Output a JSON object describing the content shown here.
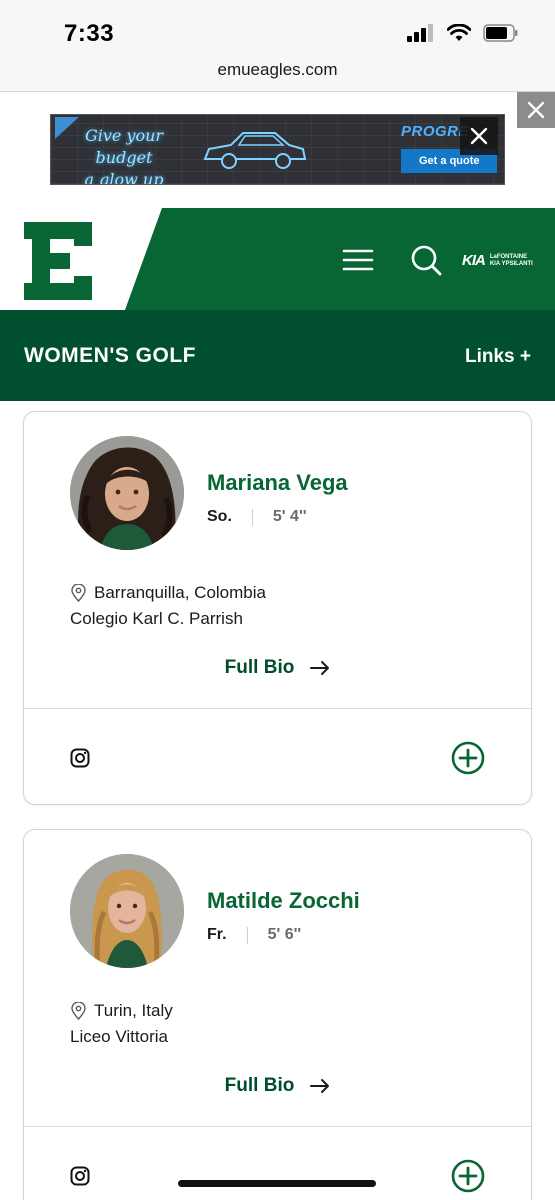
{
  "status_bar": {
    "time": "7:33"
  },
  "browser": {
    "url": "emueagles.com"
  },
  "ad": {
    "headline_line1": "Give your budget",
    "headline_line2": "a glow up",
    "brand": "PROGRE",
    "cta": "Get a quote"
  },
  "header": {
    "logo_letter": "E",
    "sponsor_mark": "KIA",
    "sponsor_name_line1": "LaFONTAINE",
    "sponsor_name_line2": "KIA YPSILANTI"
  },
  "section": {
    "title": "WOMEN'S GOLF",
    "links_label": "Links +"
  },
  "roster": [
    {
      "name": "Mariana Vega",
      "class": "So.",
      "height": "5' 4''",
      "hometown": "Barranquilla, Colombia",
      "school": "Colegio Karl C. Parrish",
      "bio_label": "Full Bio"
    },
    {
      "name": "Matilde Zocchi",
      "class": "Fr.",
      "height": "5' 6''",
      "hometown": "Turin, Italy",
      "school": "Liceo Vittoria",
      "bio_label": "Full Bio"
    }
  ],
  "icons": {
    "signal": "cellular-signal-icon",
    "wifi": "wifi-icon",
    "battery": "battery-icon",
    "menu": "hamburger-menu-icon",
    "search": "search-icon",
    "location": "location-pin-icon",
    "bio_arrow": "arrow-right-icon",
    "social": "instagram-icon",
    "expand": "plus-circle-icon",
    "close": "close-icon"
  },
  "colors": {
    "brand_green": "#076633",
    "section_green": "#005030",
    "name_green": "#076633"
  }
}
